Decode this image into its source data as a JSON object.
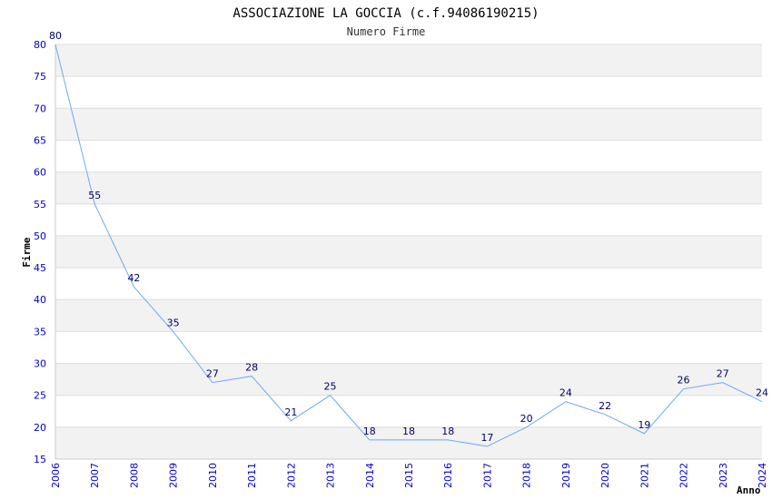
{
  "chart_data": {
    "type": "line",
    "title": "ASSOCIAZIONE LA GOCCIA (c.f.94086190215)",
    "subtitle": "Numero Firme",
    "xlabel": "Anno",
    "ylabel": "Firme",
    "categories": [
      "2006",
      "2007",
      "2008",
      "2009",
      "2010",
      "2011",
      "2012",
      "2013",
      "2014",
      "2015",
      "2016",
      "2017",
      "2018",
      "2019",
      "2020",
      "2021",
      "2022",
      "2023",
      "2024"
    ],
    "series": [
      {
        "values": [
          80,
          55,
          42,
          35,
          27,
          28,
          21,
          25,
          18,
          18,
          18,
          17,
          20,
          24,
          22,
          19,
          26,
          27,
          24
        ]
      }
    ],
    "ylim": [
      15,
      80
    ],
    "yticks": [
      15,
      20,
      25,
      30,
      35,
      40,
      45,
      50,
      55,
      60,
      65,
      70,
      75,
      80
    ],
    "grid": true,
    "colors": {
      "line": "#6aaaf0",
      "band": "#f2f2f2",
      "gridline": "#dddddd",
      "tick_label": "#0000cc",
      "data_label": "#000066"
    }
  }
}
